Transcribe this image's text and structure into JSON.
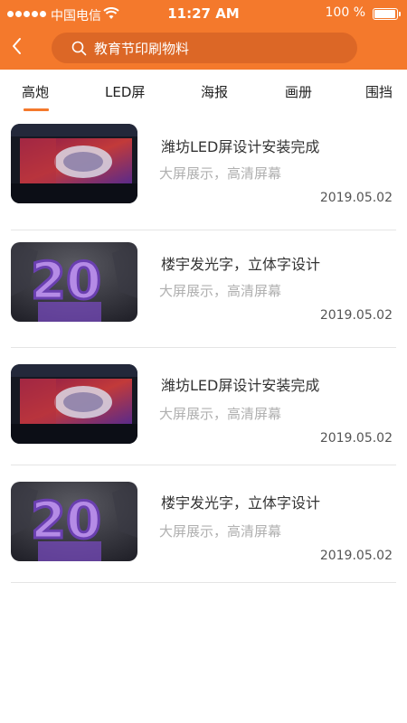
{
  "status_bar": {
    "carrier": "中国电信",
    "time": "11:27 AM",
    "battery": "100 %",
    "battery_level": 1.0
  },
  "header": {
    "back_icon": "chevron-left-icon",
    "search_icon": "search-icon",
    "search_text": "教育节印刷物料",
    "accent_color": "#f4792c"
  },
  "tabs": [
    {
      "label": "高炮",
      "active": true
    },
    {
      "label": "LED屏",
      "active": false
    },
    {
      "label": "海报",
      "active": false
    },
    {
      "label": "画册",
      "active": false
    },
    {
      "label": "围挡",
      "active": false
    }
  ],
  "items": [
    {
      "title": "潍坊LED屏设计安装完成",
      "subtitle": "大屏展示，高清屏幕",
      "date": "2019.05.02",
      "image": "led-screen-thumbnail"
    },
    {
      "title": "楼宇发光字，立体字设计",
      "subtitle": "大屏展示，高清屏幕",
      "date": "2019.05.02",
      "image": "neon-20-sign-thumbnail"
    },
    {
      "title": "潍坊LED屏设计安装完成",
      "subtitle": "大屏展示，高清屏幕",
      "date": "2019.05.02",
      "image": "led-screen-thumbnail"
    },
    {
      "title": "楼宇发光字，立体字设计",
      "subtitle": "大屏展示，高清屏幕",
      "date": "2019.05.02",
      "image": "neon-20-sign-thumbnail"
    }
  ]
}
